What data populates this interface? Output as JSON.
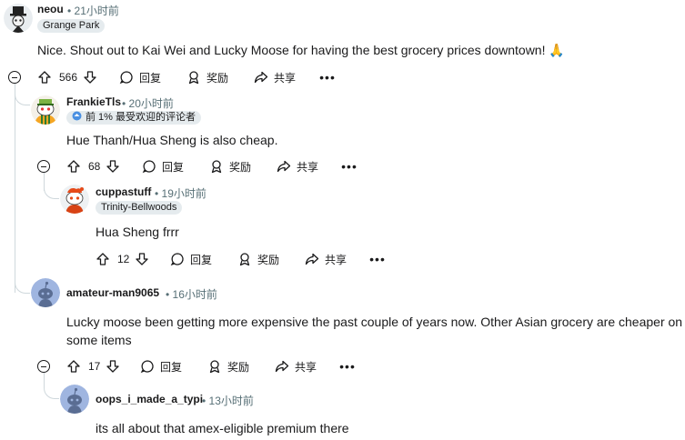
{
  "comments": [
    {
      "username": "neou",
      "time": "• 21小时前",
      "flair": "Grange Park",
      "body": "Nice. Shout out to Kai Wei and Lucky Moose for having the best grocery prices downtown! 🙏",
      "votes": "566"
    },
    {
      "username": "FrankieTls",
      "time": "• 20小时前",
      "flair": "前 1% 最受欢迎的评论者",
      "body": "Hue Thanh/Hua Sheng is also cheap.",
      "votes": "68"
    },
    {
      "username": "cuppastuff",
      "time": "• 19小时前",
      "flair": "Trinity-Bellwoods",
      "body": "Hua Sheng frrr",
      "votes": "12"
    },
    {
      "username": "amateur-man9065",
      "time": "• 16小时前",
      "body": "Lucky moose been getting more expensive the past couple of years now. Other Asian grocery are cheaper on some items",
      "votes": "17"
    },
    {
      "username": "oops_i_made_a_typi",
      "time": "• 13小时前",
      "body": "its all about that amex-eligible premium there"
    }
  ],
  "actions": {
    "reply": "回复",
    "award": "奖励",
    "share": "共享",
    "more": "•••"
  },
  "icons": {
    "upvote": "arrow-up-icon",
    "downvote": "arrow-down-icon",
    "reply": "speech-bubble-icon",
    "award": "award-icon",
    "share": "share-arrow-icon"
  },
  "colors": {
    "text": "#1a1a1b",
    "meta": "#576f76",
    "flair_bg": "#e5ebee",
    "thread_line": "#cfd8dc",
    "avatar_blue": "#9fb5e0"
  }
}
